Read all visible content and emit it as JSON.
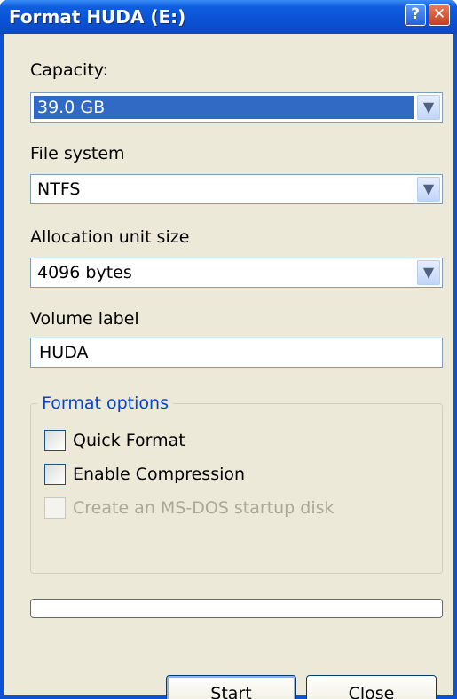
{
  "window": {
    "title": "Format HUDA (E:)",
    "help_glyph": "?",
    "close_glyph": "✕"
  },
  "capacity": {
    "label": "Capacity:",
    "value": "39.0 GB"
  },
  "file_system": {
    "label": "File system",
    "value": "NTFS"
  },
  "allocation": {
    "label": "Allocation unit size",
    "value": "4096 bytes"
  },
  "volume_label": {
    "label": "Volume label",
    "value": "HUDA"
  },
  "format_options": {
    "legend": "Format options",
    "quick_format": {
      "label": "Quick Format",
      "checked": false,
      "enabled": true
    },
    "enable_compression": {
      "label": "Enable Compression",
      "checked": false,
      "enabled": true
    },
    "msdos_startup": {
      "label": "Create an MS-DOS startup disk",
      "checked": false,
      "enabled": false
    }
  },
  "progress": {
    "value": 0
  },
  "buttons": {
    "start": "Start",
    "close": "Close"
  },
  "dropdown_glyph": "▼",
  "colors": {
    "titlebar": "#0a52d6",
    "client": "#ece9d8",
    "selection": "#316ac5",
    "group_legend": "#0046d5"
  }
}
